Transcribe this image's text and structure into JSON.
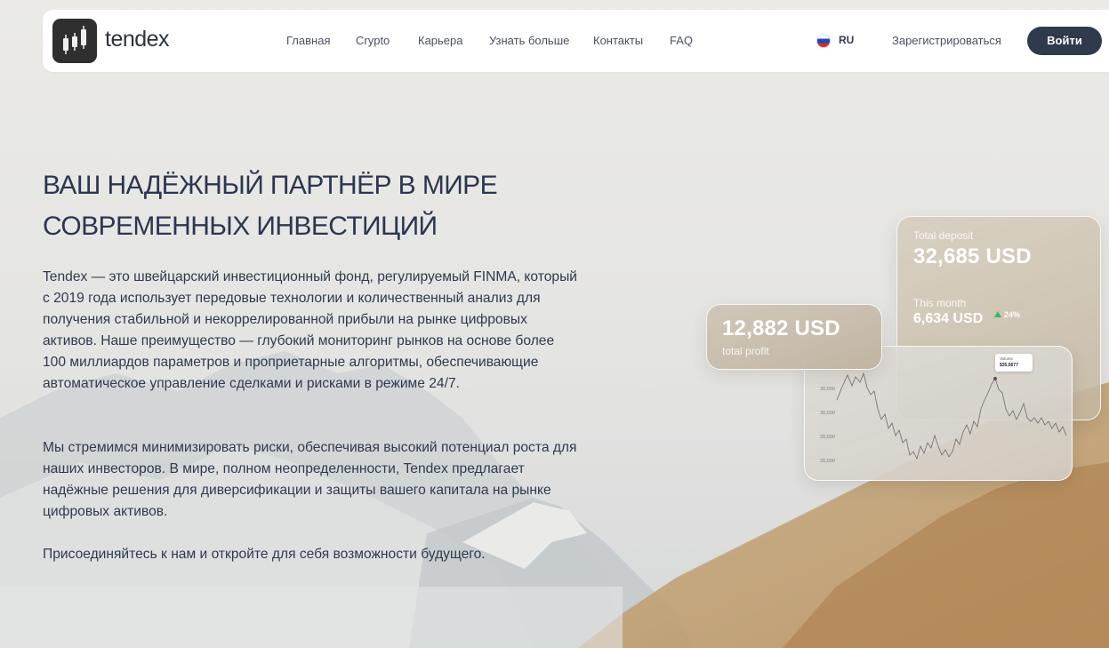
{
  "brand": {
    "name": "tendex",
    "logo_icon": "candlestick-chart-icon"
  },
  "nav": {
    "links": [
      "Главная",
      "Crypto",
      "Карьера",
      "Узнать больше",
      "Контакты",
      "FAQ"
    ],
    "language": {
      "code": "RU",
      "flag_icon": "russia-flag-icon"
    },
    "register_label": "Зарегистрироваться",
    "login_label": "Войти"
  },
  "hero": {
    "title_line1": "ВАШ НАДЁЖНЫЙ ПАРТНЁР В МИРЕ",
    "title_line2": "СОВРЕМЕННЫХ ИНВЕСТИЦИЙ",
    "paragraph1": "Tendex — это швейцарский инвестиционный фонд, регулируемый FINMA, который с 2019 года использует передовые технологии и количественный анализ для получения стабильной и некоррелированной прибыли на рынке цифровых активов. Наше преимущество — глубокий мониторинг рынков на основе более 100 миллиардов параметров и проприетарные алгоритмы, обеспечивающие автоматическое управление сделками и рисками в режиме 24/7.",
    "paragraph2": "Мы стремимся минимизировать риски, обеспечивая высокий потенциал роста для наших инвесторов. В мире, полном неопределенности, Tendex предлагает надёжные решения для диверсификации и защиты вашего капитала на рынке цифровых активов.",
    "paragraph3": "Присоединяйтесь к нам и откройте для себя возможности будущего."
  },
  "cards": {
    "deposit": {
      "label": "Total deposit",
      "value": "32,685 USD",
      "month_label": "This month",
      "month_value": "6,634 USD",
      "change": "24%",
      "change_icon": "up-triangle-icon",
      "change_color": "#3cb371"
    },
    "profit": {
      "value": "12,882 USD",
      "label": "total profit"
    },
    "chart": {
      "tooltip_label": "Volume",
      "tooltip_value": "$35,5677",
      "y_ticks": [
        "30,000",
        "30,000",
        "20,000",
        "20,000"
      ],
      "line_color": "#6b6b6b"
    }
  },
  "colors": {
    "primary": "#2f3a4d",
    "nav_bg": "#ffffff",
    "accent_up": "#3cb371"
  }
}
